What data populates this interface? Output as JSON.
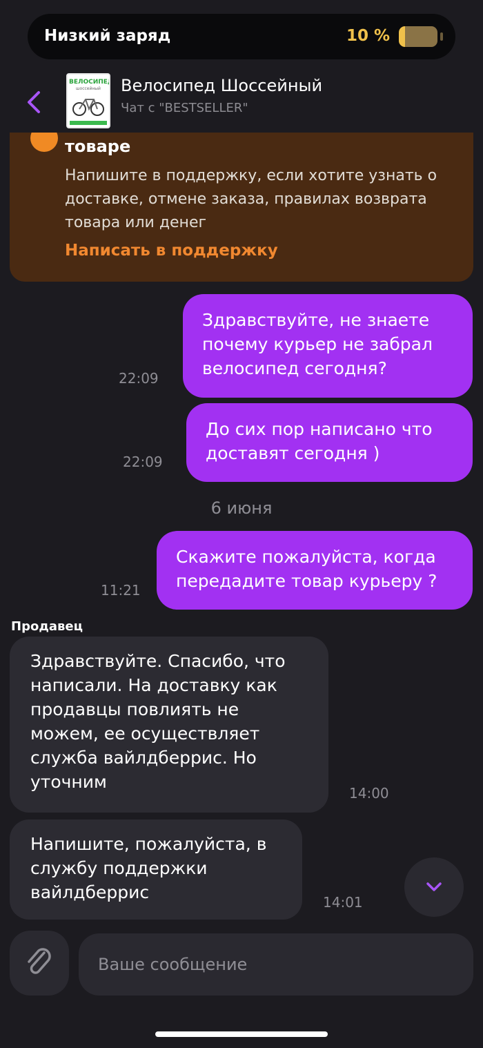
{
  "status_bar": {
    "low_battery_label": "Низкий заряд",
    "battery_percent": "10 %",
    "battery_level": 0.1
  },
  "header": {
    "title": "Велосипед Шоссейный",
    "subtitle": "Чат с \"BESTSELLER\"",
    "thumb_title": "ВЕЛОСИПЕД",
    "thumb_subtitle": "шоссейный"
  },
  "support_card": {
    "heading": "товаре",
    "text": "Напишите в поддержку, если хотите узнать о доставке, отмене заказа, правилах возврата товара или денег",
    "link_label": "Написать в поддержку"
  },
  "messages": [
    {
      "direction": "out",
      "text": "Здравствуйте, не знаете почему курьер не забрал велосипед сегодня?",
      "time": "22:09"
    },
    {
      "direction": "out",
      "text": "До сих пор написано что доставят сегодня )",
      "time": "22:09"
    },
    {
      "direction": "date",
      "text": "6 июня"
    },
    {
      "direction": "out",
      "text": "Скажите пожалуйста, когда передадите товар курьеру ?",
      "time": "11:21"
    },
    {
      "direction": "sender",
      "text": "Продавец"
    },
    {
      "direction": "in",
      "text": "Здравствуйте. Спасибо, что написали. На доставку как продавцы повлиять не можем, ее осуществляет служба вайлдберрис. Но уточним",
      "time": "14:00"
    },
    {
      "direction": "in",
      "text": "Напишите, пожалуйста, в службу поддержки вайлдберрис",
      "time": "14:01"
    }
  ],
  "composer": {
    "placeholder": "Ваше сообщение"
  },
  "colors": {
    "background": "#1c1b20",
    "outgoing_bubble": "#a231f2",
    "incoming_bubble": "#2c2b32",
    "support_card": "#4a2a12",
    "support_link": "#f18830",
    "accent": "#a855f7",
    "battery": "#f0c14b"
  },
  "icons": {
    "back": "chevron-left-icon",
    "scroll": "chevron-down-icon",
    "attach": "paperclip-icon"
  }
}
